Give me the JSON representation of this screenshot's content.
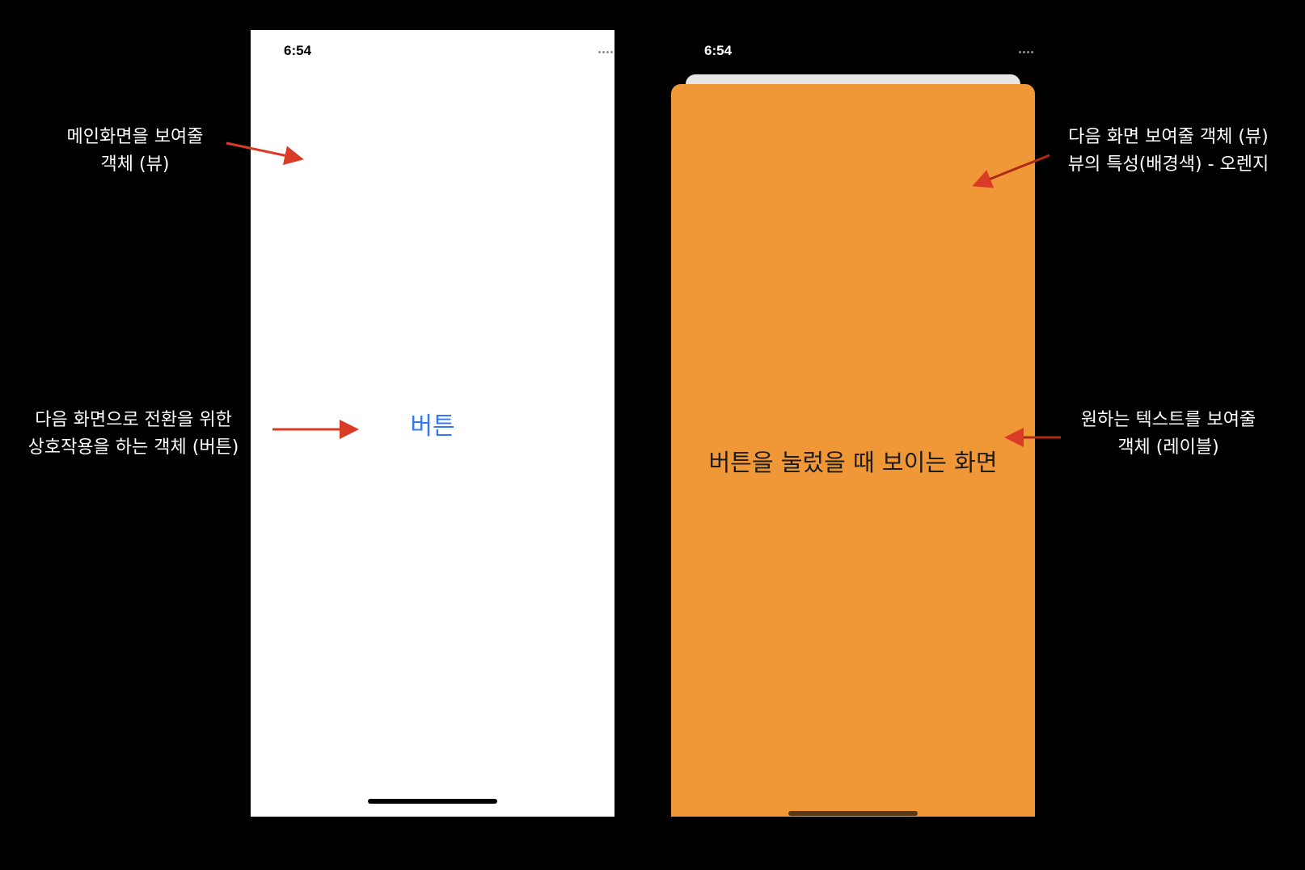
{
  "left_screen": {
    "status_time": "6:54",
    "button_label": "버튼"
  },
  "right_screen": {
    "status_time": "6:54",
    "label_text": "버튼을 눌렀을 때 보이는 화면",
    "background_color": "#f09838"
  },
  "annotations": {
    "main_view": [
      "메인화면을 보여줄",
      "객체 (뷰)"
    ],
    "button": [
      "다음 화면으로 전환을 위한",
      "상호작용을 하는 객체 (버튼)"
    ],
    "next_view": [
      "다음 화면 보여줄 객체 (뷰)",
      "뷰의 특성(배경색) - 오렌지"
    ],
    "label": [
      "원하는 텍스트를 보여줄",
      "객체 (레이블)"
    ]
  },
  "colors": {
    "button_text": "#3478f6",
    "arrow": "#d93b26",
    "page_background": "#000000"
  },
  "icons": [
    "signal-icon",
    "wifi-icon",
    "battery-icon",
    "arrow-icon"
  ]
}
